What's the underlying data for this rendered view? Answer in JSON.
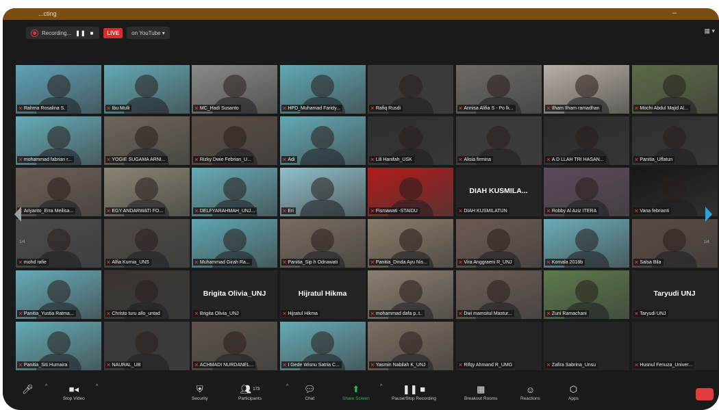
{
  "window": {
    "title": "...cting"
  },
  "recording": {
    "label": "Recording...",
    "pause": "❚❚",
    "stop": "■",
    "live": "LIVE",
    "live_on": "on YouTube ▾"
  },
  "pages": {
    "left": "1/4",
    "right": "1/4"
  },
  "participants": [
    {
      "name": "Rahma Rosalina S.",
      "color": "#5ea3b8",
      "active": true
    },
    {
      "name": "Ibu Mulli",
      "color": "#62aab5"
    },
    {
      "name": "MC_Hadi Susanto",
      "color": "#8a8a86"
    },
    {
      "name": "HPD_Muhamad Faridy...",
      "color": "#5fa9b5"
    },
    {
      "name": "Rafiq Rusdi",
      "color": "#3a3a3a"
    },
    {
      "name": "Annisa Alifia S - Po lk...",
      "color": "#6f6a66"
    },
    {
      "name": "Ilham Ilham ramadhan",
      "color": "#b9b0a6"
    },
    {
      "name": "Mochi Abdul Majid Al...",
      "color": "#5c6a45"
    },
    {
      "name": "mohammad fabrian r...",
      "color": "#64acb8"
    },
    {
      "name": "YOGIE SUGAMA ARNI...",
      "color": "#6e665b"
    },
    {
      "name": "Rizky Dwie Febrian_U...",
      "color": "#5a4d45"
    },
    {
      "name": "Adi",
      "color": "#62a9b5"
    },
    {
      "name": "Lili Hanifah_USK",
      "color": "#2e2e2e"
    },
    {
      "name": "Alisia firmina",
      "color": "#3a3a3a"
    },
    {
      "name": "A D LLAH TRI HASAN...",
      "color": "#2a2a2a"
    },
    {
      "name": "Panitia_Uffatun",
      "color": "#2e2e2e"
    },
    {
      "name": "Ariyanto_Erra Meilisa...",
      "color": "#6e5e55"
    },
    {
      "name": "EGY ANDARWATI FO...",
      "color": "#8a8473"
    },
    {
      "name": "DELFYARAHMAH_UNJ...",
      "color": "#66abb7"
    },
    {
      "name": "Eri",
      "color": "#8fbfca"
    },
    {
      "name": "Fismawati -STAIDU",
      "color": "#b11a1a"
    },
    {
      "name": "DIAH KUSMILATUN",
      "color": "#242424",
      "big": "DIAH KUSMILA..."
    },
    {
      "name": "Robby Al Aziz ITERA",
      "color": "#5b4a5a"
    },
    {
      "name": "Vana febrianti",
      "color": "#161616"
    },
    {
      "name": "mohd rafie",
      "color": "#4a4a4a"
    },
    {
      "name": "Alfia Kurnia_UNS",
      "color": "#4f4944"
    },
    {
      "name": "Muhammad Girah Ra...",
      "color": "#5fa6b2"
    },
    {
      "name": "Panitia_Sip h Odnawati",
      "color": "#7a6c60"
    },
    {
      "name": "Panitia_Dinda Ayu Nis...",
      "color": "#8b7c68"
    },
    {
      "name": "Vira Anggraeni R_UNJ",
      "color": "#6d5a52"
    },
    {
      "name": "Komala 2018b",
      "color": "#6aacb8"
    },
    {
      "name": "Salsa Bila",
      "color": "#5a4a44"
    },
    {
      "name": "Panitia_Yustia Ratma...",
      "color": "#64abb7"
    },
    {
      "name": "Christo turu allo_untad",
      "color": "#3a342f"
    },
    {
      "name": "Brigita Olivia_UNJ",
      "color": "#242424",
      "big": "Brigita Olivia_UNJ"
    },
    {
      "name": "Hijratul Hikma",
      "color": "#242424",
      "big": "Hijratul Hikma"
    },
    {
      "name": "mohammad dafa p..t..",
      "color": "#8b7f70"
    },
    {
      "name": "Dwi mamsitul Mastur...",
      "color": "#6b5d56"
    },
    {
      "name": "Zuni Ramachani",
      "color": "#5c7a4a"
    },
    {
      "name": "Taryudi UNJ",
      "color": "#242424",
      "big": "Taryudi UNJ"
    },
    {
      "name": "Panitia_Siti Humaira",
      "color": "#62aab5"
    },
    {
      "name": "NAURAL_UB",
      "color": "#3a3a3a"
    },
    {
      "name": "ACHMADI NURDANEL...",
      "color": "#5d544c"
    },
    {
      "name": "I Gede Wisnu Satria C...",
      "color": "#64aab6"
    },
    {
      "name": "Yasmin Nabilah K_UNJ",
      "color": "#7c6d60"
    },
    {
      "name": "Rifqy Ahmand R_UMG",
      "color": "#242424",
      "big": ""
    },
    {
      "name": "Zafira Sabrina_Unsu",
      "color": "#242424",
      "big": ""
    },
    {
      "name": "Husnul Fenuza_Univer...",
      "color": "#242424",
      "big": ""
    }
  ],
  "toolbar": {
    "stop_video": "Stop Video",
    "security": "Security",
    "participants": "Participants",
    "participant_count": "173",
    "chat": "Chat",
    "share": "Share Screen",
    "pause_rec": "Pause/Stop Recording",
    "breakout": "Breakout Rooms",
    "reactions": "Reactions",
    "apps": "Apps"
  }
}
